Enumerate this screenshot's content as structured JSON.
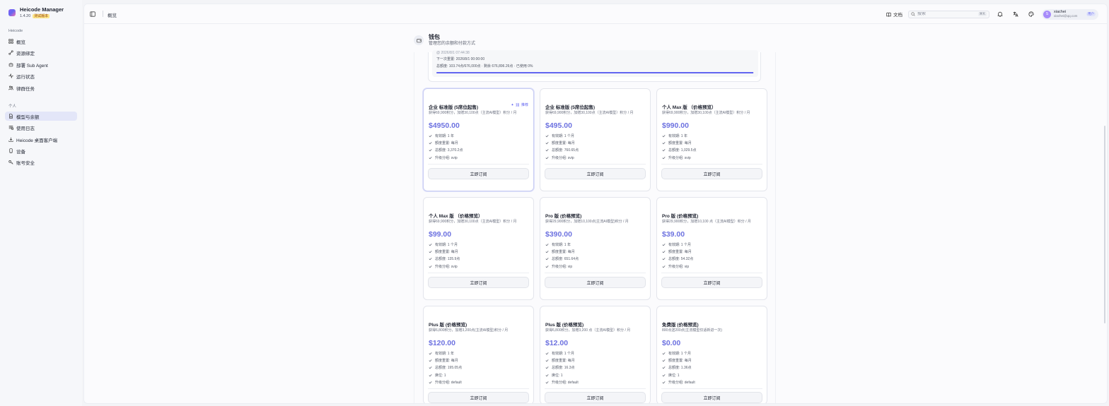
{
  "app": {
    "name": "Heicode Manager",
    "version": "1.4.20",
    "version_badge": "测试版本"
  },
  "sidebar": {
    "section_heicode": "Heicode",
    "heicode_items": [
      {
        "label": "概览",
        "icon": "grid-icon"
      },
      {
        "label": "资源绑定",
        "icon": "link-icon"
      },
      {
        "label": "部署 Sub Agent",
        "icon": "bot-icon"
      },
      {
        "label": "运行状态",
        "icon": "activity-icon"
      },
      {
        "label": "律群任务",
        "icon": "users-icon"
      }
    ],
    "section_personal": "个人",
    "personal_items": [
      {
        "label": "模型与余额",
        "icon": "file-icon",
        "active": true
      },
      {
        "label": "使用日志",
        "icon": "list-icon"
      },
      {
        "label": "Heicode 桌面客户端",
        "icon": "download-icon"
      },
      {
        "label": "设备",
        "icon": "device-icon"
      },
      {
        "label": "账号安全",
        "icon": "key-icon"
      }
    ]
  },
  "topbar": {
    "breadcrumb": "概览",
    "docs_label": "文档",
    "search_placeholder": "搜索",
    "search_shortcut": "⌘K",
    "user": {
      "initial": "S",
      "name": "xiachei",
      "email": "xiachei@qq.com",
      "role": "用户"
    }
  },
  "page": {
    "title": "钱包",
    "subtitle": "管理您的余额和付款方式"
  },
  "subscription": {
    "faded_line": "@ 2026/8/1 07:44:38",
    "next_reset": "下一次重置: 2026/8/1 00:00:00",
    "quota": "总额度: 103.74点/676,000点 · 剩余 676,896.26点 · 已使用 0%",
    "used_fraction": 0.998
  },
  "plans": [
    {
      "name": "企业 标准版 (5席位起售)",
      "desc": "获得69,900积分，加赠30,100点（主流AI模型）积分 / 月",
      "price": "$4950.00",
      "recommended": true,
      "recommended_label": "推荐",
      "features": [
        "有效期: 1 年",
        "额度重置: 每月",
        "总额度: 3,370.2点",
        "升级分组: svip"
      ],
      "button": "立即订阅"
    },
    {
      "name": "企业 标准版 (5席位起售)",
      "desc": "获得69,900积分，加赠30,100点（主流AI模型）积分 / 月",
      "price": "$495.00",
      "features": [
        "有效期: 1 个月",
        "额度重置: 每月",
        "总额度: 760.65点",
        "升级分组: svip"
      ],
      "button": "立即订阅"
    },
    {
      "name": "个人 Max 版 （价格预览）",
      "desc": "获得69,900积分，加赠30,100点（主流AI模型）积分 / 月",
      "price": "$990.00",
      "features": [
        "有效期: 1 年",
        "额度重置: 每月",
        "总额度: 1,029.5点",
        "升级分组: svip"
      ],
      "button": "立即订阅"
    },
    {
      "name": "个人 Max 版 （价格预览）",
      "desc": "获得69,900积分，加赠30,100点（主流AI模型）积分 / 月",
      "price": "$99.00",
      "features": [
        "有效期: 1 个月",
        "额度重置: 每月",
        "总额度: 135.9点",
        "升级分组: svip"
      ],
      "button": "立即订阅"
    },
    {
      "name": "Pro 版 (价格预览)",
      "desc": "获得29,900积分，加赠10,100点(主流AI模型)积分 / 月",
      "price": "$390.00",
      "features": [
        "有效期: 1 年",
        "额度重置: 每月",
        "总额度: 651.64点",
        "升级分组: vip"
      ],
      "button": "立即订阅"
    },
    {
      "name": "Pro 版 (价格预览)",
      "desc": "获得29,900积分，加赠10,100 点（主流AI模型）积分 / 月",
      "price": "$39.00",
      "features": [
        "有效期: 1 个月",
        "额度重置: 每月",
        "总额度: 54.32点",
        "升级分组: vip"
      ],
      "button": "立即订阅"
    },
    {
      "name": "Plus 版 (价格预览)",
      "desc": "获得6,800积分，加赠3,200点(主流AI模型)积分 / 月",
      "price": "$120.00",
      "features": [
        "有效期: 1 年",
        "额度重置: 每月",
        "总额度: 195.05点",
        "席位: 1",
        "升级分组: default"
      ],
      "button": "立即订阅"
    },
    {
      "name": "Plus 版 (价格预览)",
      "desc": "获得6,800积分，加赠3,200 点（主流AI模型）积分 / 月",
      "price": "$12.00",
      "features": [
        "有效期: 1 个月",
        "额度重置: 每月",
        "总额度: 16.3点",
        "席位: 1",
        "升级分组: default"
      ],
      "button": "立即订阅"
    },
    {
      "name": "免费版 (价格预览)",
      "desc": "800点送200点(主流模型仅适新进一次)",
      "price": "$0.00",
      "features": [
        "有效期: 1 个月",
        "额度重置: 每月",
        "总额度: 1.36点",
        "席位: 1",
        "升级分组: default"
      ],
      "button": "立即订阅"
    }
  ],
  "colors": {
    "accent": "#6366f1",
    "price": "#6d72e0",
    "active_nav": "#e3e6f8"
  }
}
